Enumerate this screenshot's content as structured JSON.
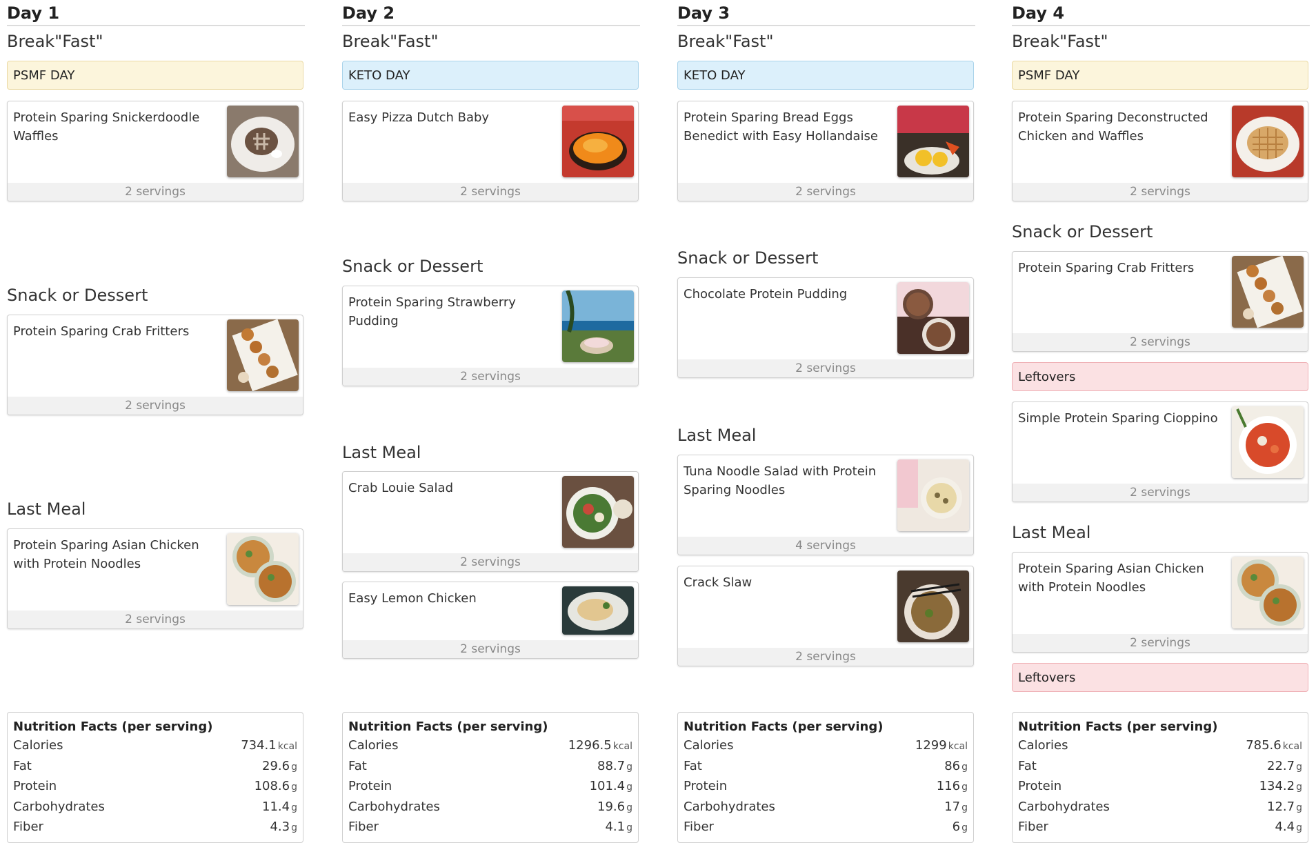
{
  "days": [
    {
      "title": "Day 1",
      "breakfast_label": "Break\"Fast\"",
      "tag": "PSMF DAY",
      "breakfast_recipe": {
        "name": "Protein Sparing Snickerdoodle Waffles",
        "servings": "2 servings"
      },
      "snack_label": "Snack or Dessert",
      "snack_recipe": {
        "name": "Protein Sparing Crab Fritters",
        "servings": "2 servings"
      },
      "last_meal_label": "Last Meal",
      "last_meal_recipe": {
        "name": "Protein Sparing Asian Chicken with Protein Noodles",
        "servings": "2 servings"
      },
      "nutrition": {
        "title": "Nutrition Facts (per serving)",
        "rows": [
          {
            "label": "Calories",
            "value": "734.1",
            "unit": "kcal"
          },
          {
            "label": "Fat",
            "value": "29.6",
            "unit": "g"
          },
          {
            "label": "Protein",
            "value": "108.6",
            "unit": "g"
          },
          {
            "label": "Carbohydrates",
            "value": "11.4",
            "unit": "g"
          },
          {
            "label": "Fiber",
            "value": "4.3",
            "unit": "g"
          }
        ]
      }
    },
    {
      "title": "Day 2",
      "breakfast_label": "Break\"Fast\"",
      "tag": "KETO DAY",
      "breakfast_recipe": {
        "name": "Easy Pizza Dutch Baby",
        "servings": "2 servings"
      },
      "snack_label": "Snack or Dessert",
      "snack_recipe": {
        "name": "Protein Sparing Strawberry Pudding",
        "servings": "2 servings"
      },
      "last_meal_label": "Last Meal",
      "last_meal_recipe": {
        "name": "Crab Louie Salad",
        "servings": "2 servings"
      },
      "last_meal_recipe_2": {
        "name": "Easy Lemon Chicken",
        "servings": "2 servings"
      },
      "nutrition": {
        "title": "Nutrition Facts (per serving)",
        "rows": [
          {
            "label": "Calories",
            "value": "1296.5",
            "unit": "kcal"
          },
          {
            "label": "Fat",
            "value": "88.7",
            "unit": "g"
          },
          {
            "label": "Protein",
            "value": "101.4",
            "unit": "g"
          },
          {
            "label": "Carbohydrates",
            "value": "19.6",
            "unit": "g"
          },
          {
            "label": "Fiber",
            "value": "4.1",
            "unit": "g"
          }
        ]
      }
    },
    {
      "title": "Day 3",
      "breakfast_label": "Break\"Fast\"",
      "tag": "KETO DAY",
      "breakfast_recipe": {
        "name": "Protein Sparing Bread Eggs Benedict with Easy Hollandaise",
        "servings": "2 servings"
      },
      "snack_label": "Snack or Dessert",
      "snack_recipe": {
        "name": "Chocolate Protein Pudding",
        "servings": "2 servings"
      },
      "last_meal_label": "Last Meal",
      "last_meal_recipe": {
        "name": "Tuna Noodle Salad with Protein Sparing Noodles",
        "servings": "4 servings"
      },
      "last_meal_recipe_2": {
        "name": "Crack Slaw",
        "servings": "2 servings"
      },
      "nutrition": {
        "title": "Nutrition Facts (per serving)",
        "rows": [
          {
            "label": "Calories",
            "value": "1299",
            "unit": "kcal"
          },
          {
            "label": "Fat",
            "value": "86",
            "unit": "g"
          },
          {
            "label": "Protein",
            "value": "116",
            "unit": "g"
          },
          {
            "label": "Carbohydrates",
            "value": "17",
            "unit": "g"
          },
          {
            "label": "Fiber",
            "value": "6",
            "unit": "g"
          }
        ]
      }
    },
    {
      "title": "Day 4",
      "breakfast_label": "Break\"Fast\"",
      "tag": "PSMF DAY",
      "breakfast_recipe": {
        "name": "Protein Sparing Deconstructed Chicken and Waffles",
        "servings": "2 servings"
      },
      "snack_label": "Snack or Dessert",
      "snack_recipe": {
        "name": "Protein Sparing Crab Fritters",
        "servings": "2 servings"
      },
      "leftovers_tag": "Leftovers",
      "snack_recipe_2": {
        "name": "Simple Protein Sparing Cioppino",
        "servings": "2 servings"
      },
      "last_meal_label": "Last Meal",
      "last_meal_recipe": {
        "name": "Protein Sparing Asian Chicken with Protein Noodles",
        "servings": "2 servings"
      },
      "leftovers_tag_2": "Leftovers",
      "nutrition": {
        "title": "Nutrition Facts (per serving)",
        "rows": [
          {
            "label": "Calories",
            "value": "785.6",
            "unit": "kcal"
          },
          {
            "label": "Fat",
            "value": "22.7",
            "unit": "g"
          },
          {
            "label": "Protein",
            "value": "134.2",
            "unit": "g"
          },
          {
            "label": "Carbohydrates",
            "value": "12.7",
            "unit": "g"
          },
          {
            "label": "Fiber",
            "value": "4.4",
            "unit": "g"
          }
        ]
      }
    }
  ],
  "colors": {
    "psmf_tag_bg": "#fcf5dc",
    "keto_tag_bg": "#dcf0fb",
    "leftovers_tag_bg": "#fbe1e3"
  },
  "icons": {
    "waffles": "waffle-plate-photo",
    "crab_fritters": "crab-fritters-photo",
    "asian_chicken": "asian-chicken-bowls-photo",
    "dutch_baby": "pizza-dutch-baby-photo",
    "strawberry_pudding": "beach-pudding-photo",
    "crab_louie": "crab-louie-salad-photo",
    "lemon_chicken": "lemon-chicken-photo",
    "eggs_benedict": "eggs-benedict-photo",
    "chocolate_pudding": "egg-pudding-photo",
    "tuna_noodle": "noodle-salad-photo",
    "crack_slaw": "crack-slaw-photo",
    "deconstructed_waffles": "chicken-waffles-photo",
    "cioppino": "cioppino-photo"
  }
}
